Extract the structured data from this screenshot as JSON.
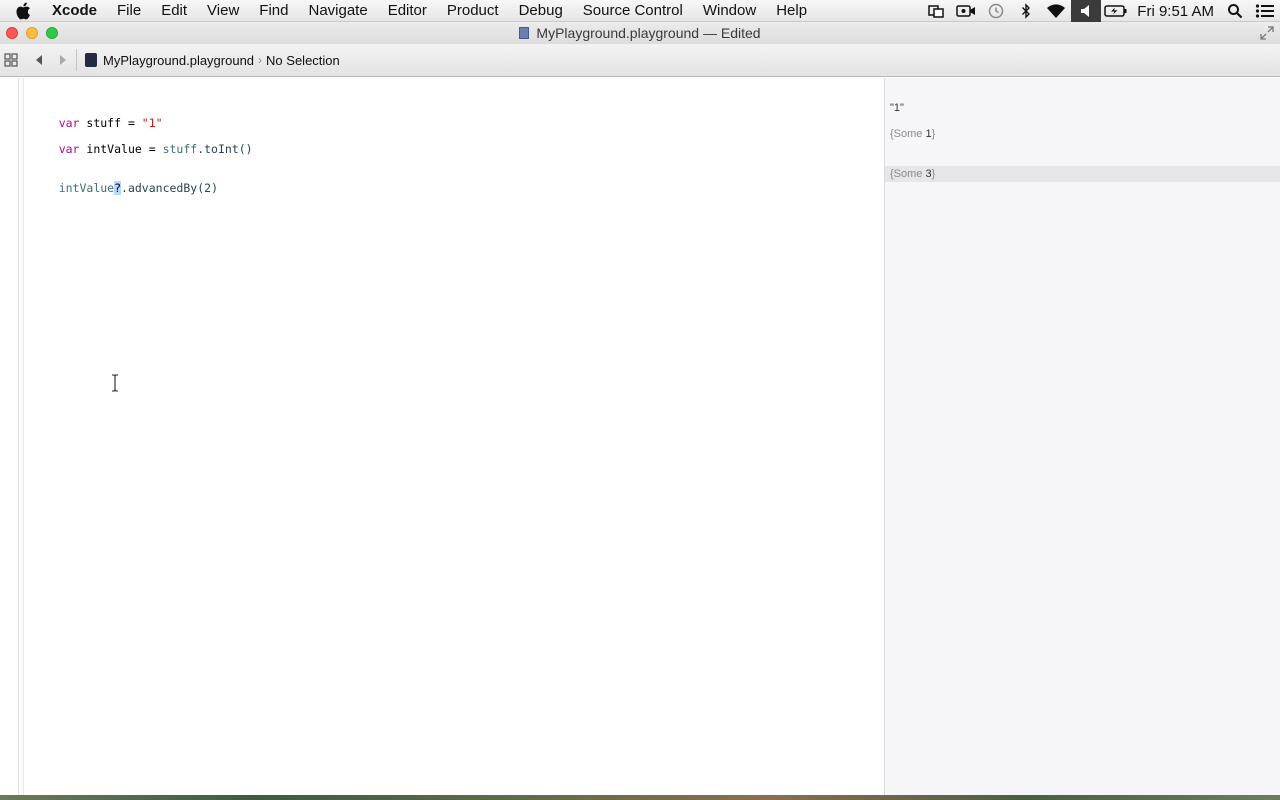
{
  "menubar": {
    "app_name": "Xcode",
    "items": [
      "File",
      "Edit",
      "View",
      "Find",
      "Navigate",
      "Editor",
      "Product",
      "Debug",
      "Source Control",
      "Window",
      "Help"
    ],
    "clock": "Fri 9:51 AM",
    "status_icons": [
      "screen-share-icon",
      "camera-icon",
      "time-machine-icon",
      "bluetooth-icon",
      "wifi-icon",
      "volume-icon",
      "battery-icon",
      "spotlight-icon",
      "notification-center-icon"
    ]
  },
  "window": {
    "title": "MyPlayground.playground — Edited"
  },
  "jumpbar": {
    "file": "MyPlayground.playground",
    "selection": "No Selection"
  },
  "editor": {
    "lines": [
      {
        "keyword": "var",
        "name": " stuff = ",
        "string": "\"1\""
      },
      {
        "keyword": "var",
        "name": " intValue = ",
        "ident": "stuff",
        "call": ".toInt()"
      },
      {
        "ident": "intValue",
        "selected": "?",
        "call": ".advancedBy(",
        "num": "2",
        "close": ")"
      }
    ]
  },
  "results": [
    {
      "text": "\"1\""
    },
    {
      "prefix": "{Some ",
      "value": "1",
      "suffix": "}"
    },
    {
      "prefix": "{Some ",
      "value": "3",
      "suffix": "}"
    }
  ],
  "colors": {
    "keyword": "#aa0d91",
    "string": "#c41a16",
    "identifier": "#3f6e74",
    "number": "#1c00cf",
    "selection": "#b3d7ff",
    "results_bg": "#f6f5f8"
  }
}
